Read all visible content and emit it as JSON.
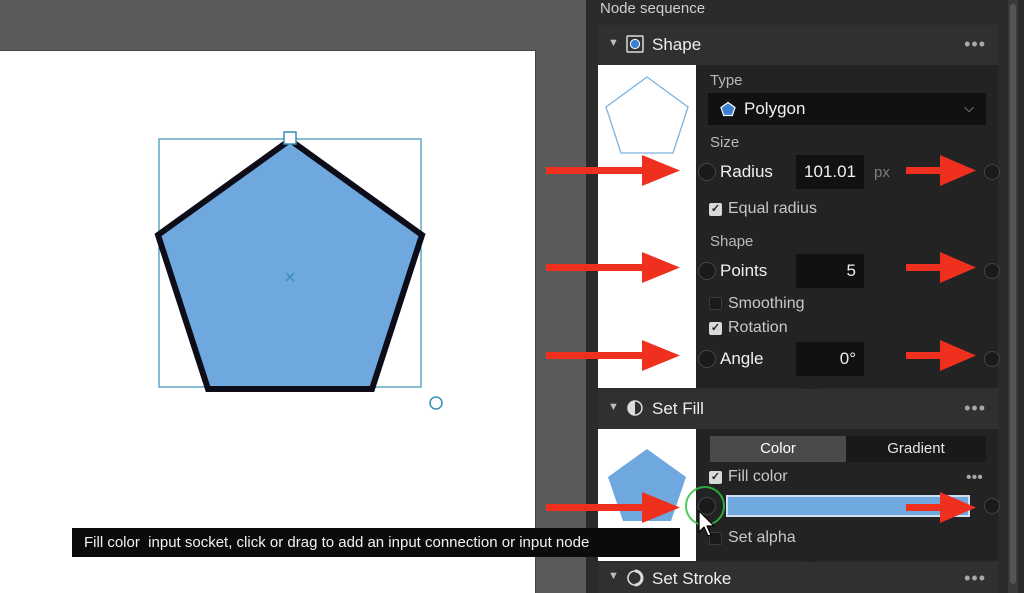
{
  "panel": {
    "title": "Node sequence"
  },
  "tooltip": {
    "text": "Fill color  input socket, click or drag to add an input connection or input node"
  },
  "shape_node": {
    "title": "Shape",
    "menu": "•••",
    "type_label": "Type",
    "type_value": "Polygon",
    "size_label": "Size",
    "radius_label": "Radius",
    "radius_value": "101.01",
    "radius_unit": "px",
    "equal_radius_label": "Equal radius",
    "equal_radius_checked": true,
    "shape_label": "Shape",
    "points_label": "Points",
    "points_value": "5",
    "smoothing_label": "Smoothing",
    "smoothing_checked": false,
    "rotation_label": "Rotation",
    "rotation_checked": true,
    "angle_label": "Angle",
    "angle_value": "0°"
  },
  "fill_node": {
    "title": "Set Fill",
    "menu": "•••",
    "tab_color": "Color",
    "tab_gradient": "Gradient",
    "fill_color_label": "Fill color",
    "fill_color_checked": true,
    "fill_color_menu": "•••",
    "fill_color_value": "#6fa8de",
    "set_alpha_label": "Set alpha",
    "set_alpha_checked": false
  },
  "stroke_node": {
    "title": "Set Stroke",
    "menu": "•••"
  },
  "colors": {
    "polygon_fill": "#6fa8de",
    "polygon_stroke": "#0d0d1a",
    "selection": "#3a8fb7",
    "annotation_arrow": "#f0301e",
    "cursor_ring": "#2fbf3f"
  }
}
